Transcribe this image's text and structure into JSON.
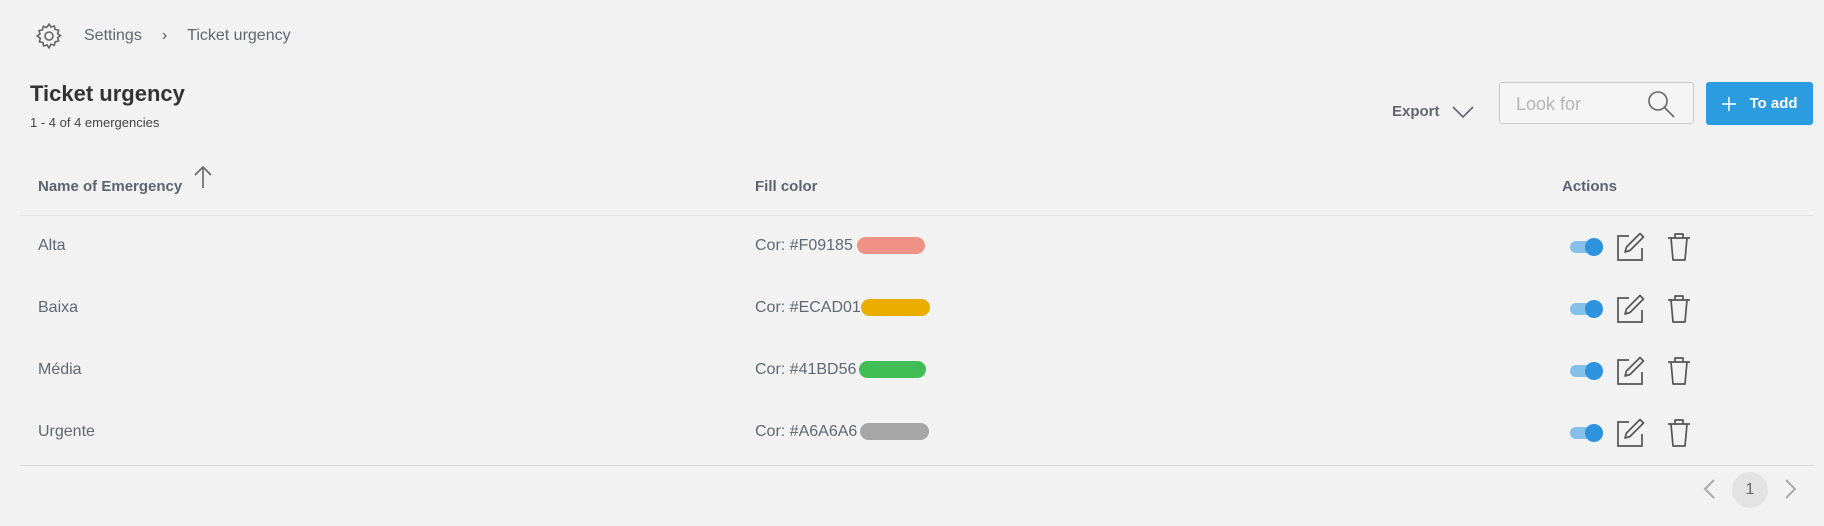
{
  "breadcrumb": {
    "icon": "gear-icon",
    "items": [
      "Settings",
      "Ticket urgency"
    ],
    "separator": "›"
  },
  "page": {
    "title": "Ticket urgency",
    "subtitle": "1 - 4 of 4 emergencies"
  },
  "toolbar": {
    "export_label": "Export",
    "search_placeholder": "Look for",
    "add_label": "To add",
    "accent": "#2C9CE0"
  },
  "table": {
    "columns": [
      "Name of Emergency",
      "Fill color",
      "Actions"
    ],
    "sort": "ascending",
    "rows": [
      {
        "name": "Alta",
        "color_text": "Cor: #F09185",
        "color": "#F09185",
        "enabled": true
      },
      {
        "name": "Baixa",
        "color_text": "Cor: #ECAD01",
        "color": "#ECAD01",
        "enabled": true
      },
      {
        "name": "Média",
        "color_text": "Cor: #41BD56",
        "color": "#41BD56",
        "enabled": true
      },
      {
        "name": "Urgente",
        "color_text": "Cor: #A6A6A6",
        "color": "#A6A6A6",
        "enabled": true
      }
    ]
  },
  "pagination": {
    "current_page": "1"
  }
}
